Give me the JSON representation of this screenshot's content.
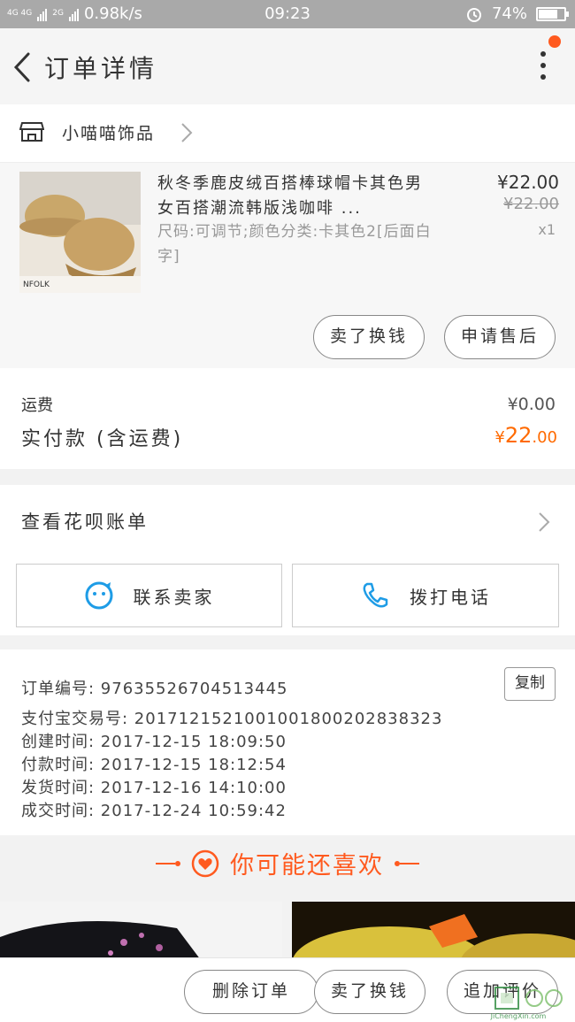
{
  "status_bar": {
    "net_tag_1": "4G 4G",
    "net_tag_2": "2G",
    "speed": "0.98k/s",
    "time": "09:23",
    "battery": "74%",
    "battery_level": 0.74
  },
  "nav": {
    "title": "订单详情",
    "has_notification": true
  },
  "shop": {
    "name": "小喵喵饰品"
  },
  "product": {
    "title": "秋冬季鹿皮绒百搭棒球帽卡其色男女百搭潮流韩版浅咖啡 ...",
    "spec": "尺码:可调节;颜色分类:卡其色2[后面白字]",
    "price": "¥22.00",
    "original_price": "¥22.00",
    "quantity": "x1",
    "image_text": "NFOLK",
    "buttons": {
      "exchange": "卖了换钱",
      "after_sale": "申请售后"
    }
  },
  "fees": {
    "shipping_label": "运费",
    "shipping_value": "¥0.00",
    "paid_label": "实付款 (含运费)",
    "paid_symbol": "¥",
    "paid_int": "22",
    "paid_dec": ".00"
  },
  "huabei": {
    "label": "查看花呗账单"
  },
  "contact": {
    "seller": "联系卖家",
    "phone": "拨打电话"
  },
  "order_info": {
    "copy": "复制",
    "lines": [
      "订单编号: 97635526704513445",
      "支付宝交易号: 2017121521001001800202838323",
      "创建时间: 2017-12-15 18:09:50",
      "付款时间: 2017-12-15 18:12:54",
      "发货时间: 2017-12-16 14:10:00",
      "成交时间: 2017-12-24 10:59:42"
    ]
  },
  "recommend": {
    "title": "你可能还喜欢"
  },
  "bottom_bar": {
    "delete": "删除订单",
    "exchange": "卖了换钱",
    "review": "追加评价"
  },
  "watermark": {
    "text": "JiChengXin.com"
  },
  "colors": {
    "accent": "#ff6a00",
    "status_bar": "#a9a9a9",
    "link_blue": "#1e9ce6"
  }
}
